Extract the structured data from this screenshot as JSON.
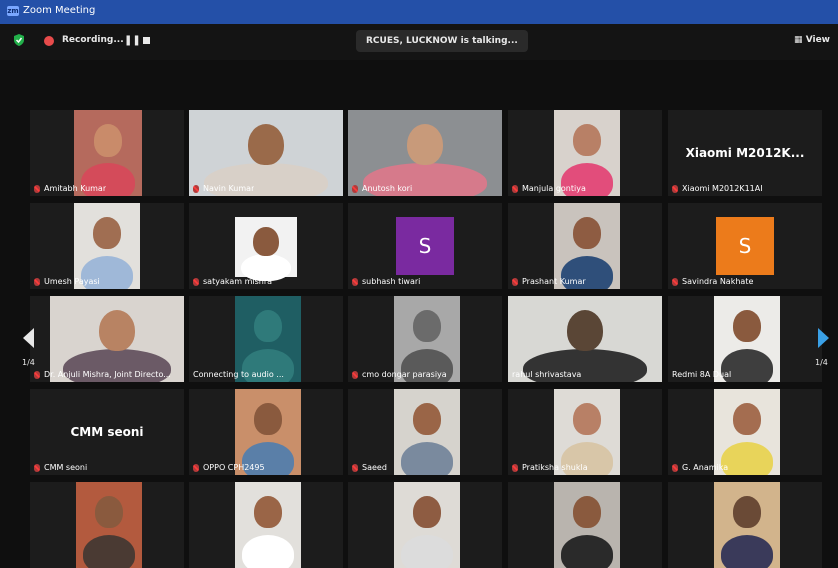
{
  "window": {
    "title": "Zoom Meeting"
  },
  "toolbar": {
    "recording_label": "Recording...",
    "pause_glyph": "❚❚",
    "active_speaker": "RCUES, LUCKNOW is talking...",
    "view_label": "View"
  },
  "pagination": {
    "left": "1/4",
    "right": "1/4"
  },
  "tiles": [
    {
      "name": "Amitabh Kumar"
    },
    {
      "name": "Navin Kumar"
    },
    {
      "name": "Anutosh kori"
    },
    {
      "name": "Manjula gontiya"
    },
    {
      "name": "Xiaomi M2012K11AI",
      "display": "Xiaomi  M2012K..."
    },
    {
      "name": "Umesh Payasi"
    },
    {
      "name": "satyakam mishra"
    },
    {
      "name": "subhash tiwari",
      "initial": "S",
      "color": "#7a2aa0"
    },
    {
      "name": "Prashant Kumar"
    },
    {
      "name": "Savindra Nakhate",
      "initial": "S",
      "color": "#ec7b1b"
    },
    {
      "name": "Dr. Anjuli Mishra, Joint Directo..."
    },
    {
      "name": "Connecting to audio ..."
    },
    {
      "name": "cmo dongar parasiya"
    },
    {
      "name": "rahul shrivastava"
    },
    {
      "name": "Redmi 8A Dual"
    },
    {
      "name": "CMM seoni",
      "display": "CMM seoni"
    },
    {
      "name": "OPPO CPH2495"
    },
    {
      "name": "Saeed"
    },
    {
      "name": "Pratiksha shukla"
    },
    {
      "name": "G. Anamika"
    },
    {
      "name": ""
    },
    {
      "name": ""
    },
    {
      "name": ""
    },
    {
      "name": ""
    },
    {
      "name": ""
    }
  ]
}
